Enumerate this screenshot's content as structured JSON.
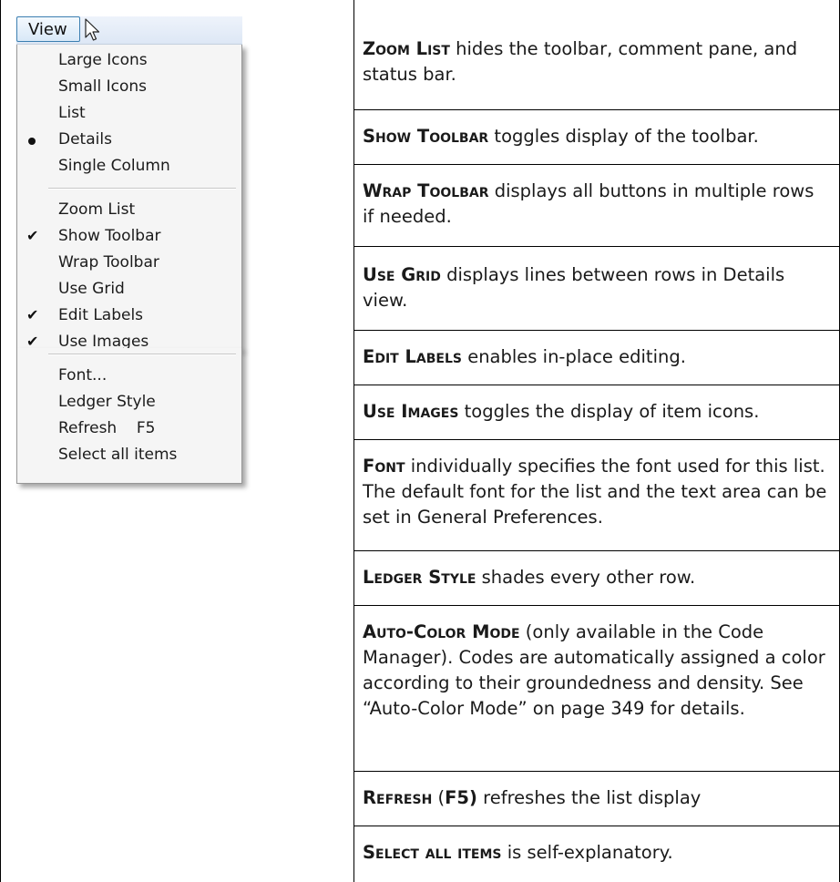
{
  "menu": {
    "title": "View",
    "items": [
      {
        "label": "Large Icons",
        "mark": ""
      },
      {
        "label": "Small Icons",
        "mark": ""
      },
      {
        "label": "List",
        "mark": ""
      },
      {
        "label": "Details",
        "mark": "bullet"
      },
      {
        "label": "Single Column",
        "mark": ""
      },
      {
        "label": "Zoom List",
        "mark": ""
      },
      {
        "label": "Show Toolbar",
        "mark": "check"
      },
      {
        "label": "Wrap Toolbar",
        "mark": ""
      },
      {
        "label": "Use Grid",
        "mark": ""
      },
      {
        "label": "Edit Labels",
        "mark": "check"
      },
      {
        "label": "Use Images",
        "mark": "check"
      },
      {
        "label": "Font...",
        "mark": ""
      },
      {
        "label": "Ledger Style",
        "mark": ""
      },
      {
        "label": "Refresh    F5",
        "mark": ""
      },
      {
        "label": "Select all items",
        "mark": ""
      }
    ]
  },
  "descriptions": {
    "zoom_list": {
      "term": "Zoom List",
      "text": " hides the toolbar, comment pane, and status bar."
    },
    "show_toolbar": {
      "term": "Show Toolbar",
      "text": " toggles display of the toolbar."
    },
    "wrap_toolbar": {
      "term": "Wrap Toolbar",
      "text": " displays all buttons in multiple rows if needed."
    },
    "use_grid": {
      "term": "Use Grid",
      "text": " displays lines between rows in Details view."
    },
    "edit_labels": {
      "term": "Edit Labels",
      "text": " enables in-place editing."
    },
    "use_images": {
      "term": "Use Images",
      "text": " toggles the display of item icons."
    },
    "font": {
      "term": "Font",
      "text": " individually specifies the font used for this list. The default font for the list and the text area can be set in General Preferences."
    },
    "ledger_style": {
      "term": "Ledger Style",
      "text": " shades every other row."
    },
    "auto_color": {
      "term": "Auto-Color Mode",
      "text": " (only available in the Code Manager). Codes are automatically assigned a color according to their groundedness and density. See “Auto-Color Mode” on page 349 for details."
    },
    "refresh": {
      "term": "Refresh",
      "paren_open": " (",
      "key": "F5)",
      "text": " refreshes the list display"
    },
    "select_all": {
      "term": "Select all items",
      "text": " is self-explanatory."
    }
  }
}
